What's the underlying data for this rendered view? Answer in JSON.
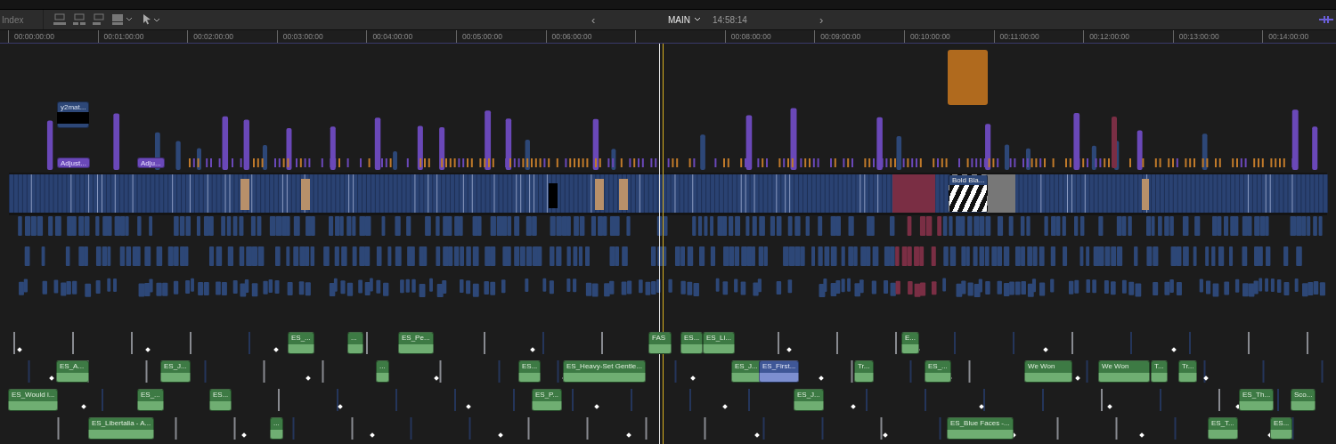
{
  "toolbar": {
    "index_label": "Index",
    "project_name": "MAIN",
    "project_duration": "14:58:14",
    "prev_symbol": "‹",
    "next_symbol": "›"
  },
  "ruler": {
    "ticks": [
      "00:00:00:00",
      "00:01:00:00",
      "00:02:00:00",
      "00:03:00:00",
      "00:04:00:00",
      "00:05:00:00",
      "00:06:00:00",
      "00:08:00:00",
      "00:09:00:00",
      "00:10:00:00",
      "00:11:00:00",
      "00:12:00:00",
      "00:13:00:00",
      "00:14:00:00"
    ]
  },
  "clips": [
    {
      "kind": "video",
      "label": "y2mat..."
    },
    {
      "kind": "adjustment",
      "label": "Adjust..."
    },
    {
      "kind": "adjustment",
      "label": "Adju..."
    },
    {
      "kind": "generator",
      "label": "Bold Bla..."
    },
    {
      "kind": "audio",
      "label": "ES_..."
    },
    {
      "kind": "audio",
      "label": "..."
    },
    {
      "kind": "audio",
      "label": "ES_Pe..."
    },
    {
      "kind": "audio",
      "label": "FAS"
    },
    {
      "kind": "audio",
      "label": "ES..."
    },
    {
      "kind": "audio",
      "label": "ES_Li..."
    },
    {
      "kind": "audio",
      "label": "E..."
    },
    {
      "kind": "audio",
      "label": "ES_A..."
    },
    {
      "kind": "audio",
      "label": "ES_J..."
    },
    {
      "kind": "audio",
      "label": "..."
    },
    {
      "kind": "audio",
      "label": "ES..."
    },
    {
      "kind": "audio",
      "label": "ES_Heavy-Set Gentle..."
    },
    {
      "kind": "audio",
      "label": "ES_J..."
    },
    {
      "kind": "audio-selected",
      "label": "ES_First..."
    },
    {
      "kind": "audio",
      "label": "Tr..."
    },
    {
      "kind": "audio",
      "label": "ES_..."
    },
    {
      "kind": "audio",
      "label": "We Won"
    },
    {
      "kind": "audio",
      "label": "We Won"
    },
    {
      "kind": "audio",
      "label": "T..."
    },
    {
      "kind": "audio",
      "label": "Tr..."
    },
    {
      "kind": "audio",
      "label": "ES_Would i..."
    },
    {
      "kind": "audio",
      "label": "ES_..."
    },
    {
      "kind": "audio",
      "label": "ES..."
    },
    {
      "kind": "audio",
      "label": "ES_P..."
    },
    {
      "kind": "audio",
      "label": "ES_J..."
    },
    {
      "kind": "audio",
      "label": "ES_Th..."
    },
    {
      "kind": "audio",
      "label": "Sco..."
    },
    {
      "kind": "audio",
      "label": "ES_Libertalia - A..."
    },
    {
      "kind": "audio",
      "label": "..."
    },
    {
      "kind": "audio",
      "label": "ES_Blue Faces -..."
    },
    {
      "kind": "audio",
      "label": "ES_T..."
    },
    {
      "kind": "audio",
      "label": "ES..."
    }
  ]
}
